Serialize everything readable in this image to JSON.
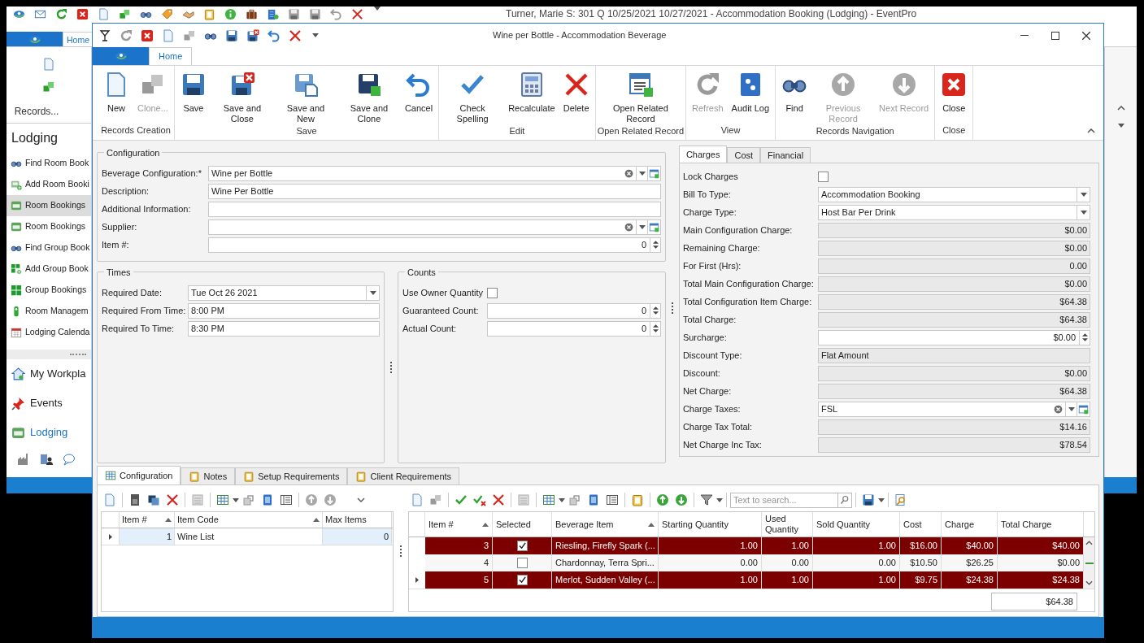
{
  "background_window": {
    "title": "Turner, Marie S: 301 Q 10/25/2021 10/27/2021 - Accommodation Booking (Lodging) - EventPro",
    "tab": "Home",
    "ribbon_group": "Records...",
    "sidebar": {
      "header": "Lodging",
      "items": [
        {
          "label": "Find Room Book",
          "selected": false
        },
        {
          "label": "Add Room Booki",
          "selected": false
        },
        {
          "label": "Room Bookings",
          "selected": true
        },
        {
          "label": "Room Bookings",
          "selected": false
        },
        {
          "label": "Find Group Book",
          "selected": false
        },
        {
          "label": "Add Group Book",
          "selected": false
        },
        {
          "label": "Group Bookings",
          "selected": false
        },
        {
          "label": "Room Managem",
          "selected": false
        },
        {
          "label": "Lodging Calenda",
          "selected": false
        }
      ],
      "nav": [
        {
          "label": "My Workpla",
          "selected": false
        },
        {
          "label": "Events",
          "selected": false
        },
        {
          "label": "Lodging",
          "selected": true
        }
      ]
    }
  },
  "dialog": {
    "title": "Wine per Bottle - Accommodation Beverage",
    "tabs": [
      {
        "label": "Home",
        "selected": true
      }
    ],
    "ribbon_groups": [
      {
        "label": "Records Creation",
        "buttons": [
          {
            "label": "New",
            "disabled": false
          },
          {
            "label": "Clone...",
            "disabled": true
          }
        ]
      },
      {
        "label": "Save",
        "buttons": [
          {
            "label": "Save",
            "disabled": false
          },
          {
            "label": "Save and Close",
            "disabled": false
          },
          {
            "label": "Save and New",
            "disabled": false
          },
          {
            "label": "Save and Clone",
            "disabled": false
          },
          {
            "label": "Cancel",
            "disabled": false
          }
        ]
      },
      {
        "label": "Edit",
        "buttons": [
          {
            "label": "Check Spelling",
            "disabled": false
          },
          {
            "label": "Recalculate",
            "disabled": false
          },
          {
            "label": "Delete",
            "disabled": false
          }
        ]
      },
      {
        "label": "Open Related Record",
        "buttons": [
          {
            "label": "Open Related Record",
            "disabled": false
          }
        ]
      },
      {
        "label": "View",
        "buttons": [
          {
            "label": "Refresh",
            "disabled": true
          },
          {
            "label": "Audit Log",
            "disabled": false
          }
        ]
      },
      {
        "label": "Records Navigation",
        "buttons": [
          {
            "label": "Find",
            "disabled": false
          },
          {
            "label": "Previous Record",
            "disabled": true
          },
          {
            "label": "Next Record",
            "disabled": true
          }
        ]
      },
      {
        "label": "Close",
        "buttons": [
          {
            "label": "Close",
            "disabled": false
          }
        ]
      }
    ],
    "configuration": {
      "title": "Configuration",
      "fields": [
        {
          "label": "Beverage Configuration:*",
          "kind": "lookup",
          "value": "Wine per Bottle"
        },
        {
          "label": "Description:",
          "kind": "text",
          "value": "Wine Per Bottle"
        },
        {
          "label": "Additional Information:",
          "kind": "text"
        },
        {
          "label": "Supplier:",
          "kind": "lookup"
        },
        {
          "label": "Item #:",
          "kind": "spin",
          "value": "0"
        }
      ]
    },
    "times": {
      "title": "Times",
      "fields": [
        {
          "label": "Required Date:",
          "kind": "dropdown",
          "value": "Tue Oct 26 2021"
        },
        {
          "label": "Required From Time:",
          "kind": "text",
          "value": "8:00 PM"
        },
        {
          "label": "Required To Time:",
          "kind": "text",
          "value": "8:30 PM"
        }
      ]
    },
    "counts": {
      "title": "Counts",
      "fields": [
        {
          "label": "Use Owner Quantity",
          "kind": "checkbox",
          "checked": false
        },
        {
          "label": "Guaranteed Count:",
          "kind": "spin",
          "value": "0"
        },
        {
          "label": "Actual Count:",
          "kind": "spin",
          "value": "0"
        }
      ]
    },
    "side_tabs": [
      {
        "label": "Charges",
        "selected": true
      },
      {
        "label": "Cost",
        "selected": false
      },
      {
        "label": "Financial",
        "selected": false
      }
    ],
    "charges": {
      "fields": [
        {
          "label": "Lock Charges",
          "kind": "checkbox",
          "checked": false
        },
        {
          "label": "Bill To Type:",
          "kind": "dropdown",
          "value": "Accommodation Booking"
        },
        {
          "label": "Charge Type:",
          "kind": "dropdown",
          "value": "Host Bar Per Drink"
        },
        {
          "label": "Main Configuration Charge:",
          "kind": "readonly",
          "value": "$0.00"
        },
        {
          "label": "Remaining Charge:",
          "kind": "readonly",
          "value": "$0.00"
        },
        {
          "label": "For First (Hrs):",
          "kind": "readonly",
          "value": "0.00"
        },
        {
          "label": "Total Main Configuration Charge:",
          "kind": "readonly",
          "value": "$0.00"
        },
        {
          "label": "Total Configuration Item Charge:",
          "kind": "readonly",
          "value": "$64.38"
        },
        {
          "label": "Total Charge:",
          "kind": "readonly",
          "value": "$64.38"
        },
        {
          "label": "Surcharge:",
          "kind": "spin",
          "value": "$0.00"
        },
        {
          "label": "Discount Type:",
          "kind": "display",
          "value": "Flat Amount"
        },
        {
          "label": "Discount:",
          "kind": "readonly",
          "value": "$0.00"
        },
        {
          "label": "Net Charge:",
          "kind": "readonly",
          "value": "$64.38"
        },
        {
          "label": "Charge Taxes:",
          "kind": "lookup",
          "value": "FSL"
        },
        {
          "label": "Charge Tax Total:",
          "kind": "readonly",
          "value": "$14.16"
        },
        {
          "label": "Net Charge Inc Tax:",
          "kind": "readonly",
          "value": "$78.54"
        }
      ]
    },
    "bottom_tabs": [
      {
        "label": "Configuration",
        "selected": true
      },
      {
        "label": "Notes",
        "selected": false
      },
      {
        "label": "Setup Requirements",
        "selected": false
      },
      {
        "label": "Client Requirements",
        "selected": false
      }
    ],
    "items_grid": {
      "columns": [
        {
          "label": "Item #",
          "sorted": true
        },
        {
          "label": "Item Code",
          "sorted": true
        },
        {
          "label": "Max Items",
          "sorted": false
        }
      ],
      "rows": [
        {
          "cells": [
            "1",
            "Wine List",
            "0"
          ],
          "current": true
        }
      ]
    },
    "beverage_grid": {
      "search_placeholder": "Text to search...",
      "columns": [
        {
          "label": "Item #",
          "sorted": true
        },
        {
          "label": "Selected",
          "sorted": false
        },
        {
          "label": "Beverage Item",
          "sorted": true
        },
        {
          "label": "Starting Quantity",
          "sorted": false
        },
        {
          "label": "Used Quantity",
          "sorted": false
        },
        {
          "label": "Sold Quantity",
          "sorted": false
        },
        {
          "label": "Cost",
          "sorted": false
        },
        {
          "label": "Charge",
          "sorted": false
        },
        {
          "label": "Total Charge",
          "sorted": false
        }
      ],
      "rows": [
        {
          "cells": [
            "3",
            "",
            "Riesling, Firefly Spark (...",
            "1.00",
            "1.00",
            "1.00",
            "$16.00",
            "$40.00",
            "$40.00"
          ],
          "selected": true,
          "current": false
        },
        {
          "cells": [
            "4",
            "",
            "Chardonnay, Terra Spri...",
            "0.00",
            "0.00",
            "0.00",
            "$10.50",
            "$26.25",
            "$0.00"
          ],
          "selected": false,
          "current": false
        },
        {
          "cells": [
            "5",
            "",
            "Merlot, Sudden Valley (...",
            "1.00",
            "1.00",
            "1.00",
            "$9.75",
            "$24.38",
            "$24.38"
          ],
          "selected": true,
          "current": true
        }
      ],
      "total": "$64.38"
    }
  }
}
